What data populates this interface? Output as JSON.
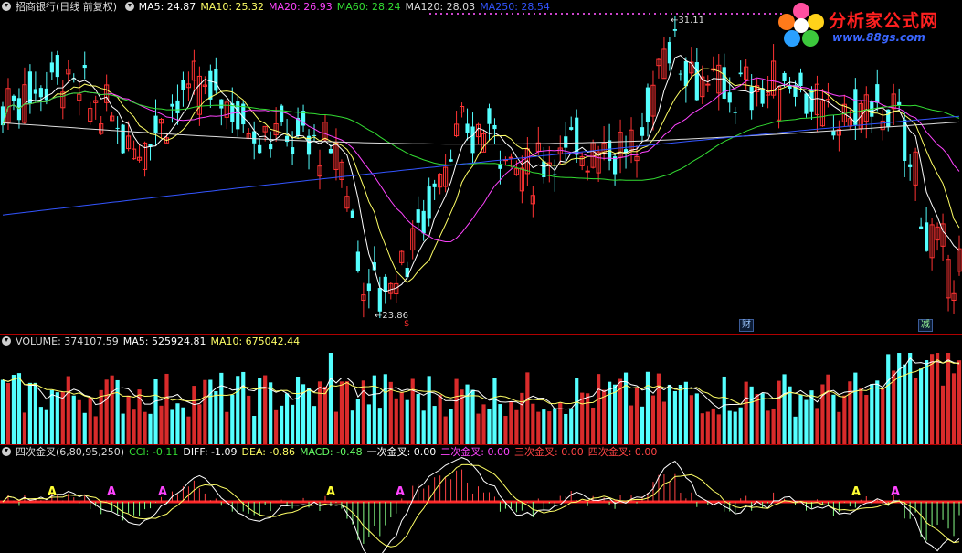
{
  "header": {
    "stock": "招商银行(日线 前复权)",
    "ma": [
      {
        "label": "MA5: 24.87",
        "color": "#ffffff"
      },
      {
        "label": "MA10: 25.32",
        "color": "#ffff66"
      },
      {
        "label": "MA20: 26.93",
        "color": "#ff44ff"
      },
      {
        "label": "MA60: 28.24",
        "color": "#33dd33"
      },
      {
        "label": "MA120: 28.03",
        "color": "#dddddd"
      },
      {
        "label": "MA250: 28.54",
        "color": "#3355ff"
      }
    ]
  },
  "logo": {
    "title": "分析家公式网",
    "url": "www.88gs.com"
  },
  "price_annotations": {
    "high": "31.11",
    "low": "23.86"
  },
  "event_marks": [
    {
      "label": "$",
      "color": "#ff3030"
    },
    {
      "label": "财",
      "color": "#9cc8ff"
    },
    {
      "label": "减",
      "color": "#9cff9c"
    }
  ],
  "volume_header": [
    {
      "label": "VOLUME: 374107.59",
      "color": "#dddddd"
    },
    {
      "label": "MA5: 525924.81",
      "color": "#ffffff"
    },
    {
      "label": "MA10: 675042.44",
      "color": "#ffff66"
    }
  ],
  "macd_header": [
    {
      "label": "四次金叉(6,80,95,250)",
      "color": "#dddddd"
    },
    {
      "label": "CCI: -0.11",
      "color": "#33dd33"
    },
    {
      "label": "DIFF: -1.09",
      "color": "#ffffff"
    },
    {
      "label": "DEA: -0.86",
      "color": "#ffff66"
    },
    {
      "label": "MACD: -0.48",
      "color": "#66ff66"
    },
    {
      "label": "一次金叉: 0.00",
      "color": "#ffffff"
    },
    {
      "label": "二次金叉: 0.00",
      "color": "#ff44ff"
    },
    {
      "label": "三次金叉: 0.00",
      "color": "#ff4444"
    },
    {
      "label": "四次金叉: 0.00",
      "color": "#ff4444"
    }
  ],
  "cross_marker_letter": "A",
  "chart_data": [
    {
      "type": "candlestick",
      "series": [
        {
          "name": "MA5",
          "value": 24.87
        },
        {
          "name": "MA10",
          "value": 25.32
        },
        {
          "name": "MA20",
          "value": 26.93
        },
        {
          "name": "MA60",
          "value": 28.24
        },
        {
          "name": "MA120",
          "value": 28.03
        },
        {
          "name": "MA250",
          "value": 28.54
        }
      ],
      "high_marker": 31.11,
      "low_marker": 23.86,
      "ylim": [
        23.3,
        31.6
      ],
      "up_color": "#ff3333",
      "down_color": "#54ffff"
    },
    {
      "type": "bar",
      "series": [
        {
          "name": "VOLUME",
          "value": 374107.59
        },
        {
          "name": "MA5",
          "value": 525924.81
        },
        {
          "name": "MA10",
          "value": 675042.44
        }
      ]
    },
    {
      "type": "bar",
      "series": [
        {
          "name": "CCI",
          "value": -0.11
        },
        {
          "name": "DIFF",
          "value": -1.09
        },
        {
          "name": "DEA",
          "value": -0.86
        },
        {
          "name": "MACD",
          "value": -0.48
        },
        {
          "name": "一次金叉",
          "value": 0.0
        },
        {
          "name": "二次金叉",
          "value": 0.0
        },
        {
          "name": "三次金叉",
          "value": 0.0
        },
        {
          "name": "四次金叉",
          "value": 0.0
        }
      ],
      "cross_colors": [
        "#ffff33",
        "#ff44ff",
        "#ff44ff",
        "#ffff33",
        "#ff44ff",
        "#ffff33",
        "#ff44ff"
      ]
    }
  ]
}
